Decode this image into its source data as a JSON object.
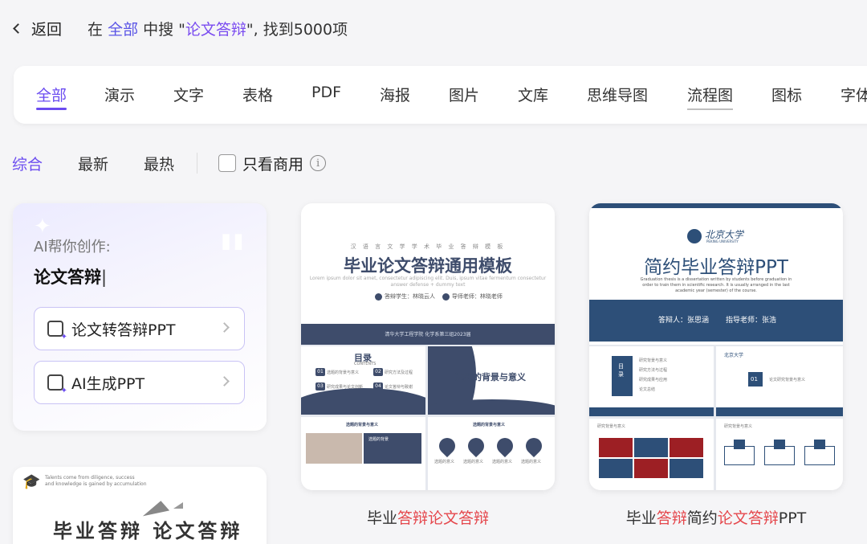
{
  "topbar": {
    "back_label": "返回",
    "summary_prefix": "在 ",
    "scope": "全部",
    "summary_mid": " 中搜 \"",
    "keyword": "论文答辩",
    "summary_suffix": "\", 找到5000项"
  },
  "tabs": [
    "全部",
    "演示",
    "文字",
    "表格",
    "PDF",
    "海报",
    "图片",
    "文库",
    "思维导图",
    "流程图",
    "图标",
    "字体"
  ],
  "active_tab": "全部",
  "sort": {
    "options": [
      "综合",
      "最新",
      "最热"
    ],
    "active": "综合",
    "commercial_only_label": "只看商用"
  },
  "ai_card": {
    "label": "AI帮你创作:",
    "topic": "论文答辩",
    "buttons": [
      "论文转答辩PPT",
      "AI生成PPT"
    ]
  },
  "bottom_left_preview": {
    "small_text_1": "Talents come from diligence, success",
    "small_text_2": "and knowledge is gained by accumulation",
    "big_text": "毕业答辩 论文答辩"
  },
  "card1": {
    "preview": {
      "small_caption": "汉 语 言 文 学 学 术 毕 业 答 辩 模 板",
      "title": "毕业论文答辩通用模板",
      "subtitle": "Lorem ipsum dolor sit amet, consectetur adipiscing elit. Duis, ipsum vitae fermentum consectetur",
      "subtitle_2": "answer defense + dummy text",
      "speaker": "答辩学生：林晓云人",
      "advisor": "导师老师：林晓老师",
      "school": "清华大学工程学院 化学系第三组2023届",
      "toc_title": "目录",
      "toc_sub": "CONTENTS",
      "toc_items": [
        "选题的背景与意义",
        "研究方法及过程",
        "研究成果与论文创新",
        "论文答辩与致谢"
      ],
      "slide2_title": "选题的背景与意义",
      "slide3_title": "选题的背景与意义",
      "slide3_box": "选题的背景",
      "slide4_title": "选题的背景与意义",
      "pin_labels": [
        "选题的意义",
        "选题的意义",
        "选题的意义",
        "选题的意义"
      ]
    },
    "title_parts": [
      {
        "text": "毕业",
        "highlight": false
      },
      {
        "text": "答辩论文答辩",
        "highlight": true
      }
    ]
  },
  "card2": {
    "preview": {
      "logo_text": "北京大学",
      "logo_sub": "PEKING UNIVERSITY",
      "title": "简约毕业答辩PPT",
      "subtitle": "Graduation thesis is a dissertation written by students before graduation in order to train them in scientific research. It is usually arranged in the last academic year (semester) of the course.",
      "speaker": "答辩人：张思涵",
      "advisor": "指导老师：张浩",
      "toc_side": "目录",
      "toc_items": [
        "研究背景与意义",
        "研究方法与过程",
        "研究成果与应用",
        "论文总结"
      ],
      "section_num": "01",
      "section_title": "论文研究背景与意义",
      "slide3_title": "研究背景与意义",
      "slide4_title": "研究背景与意义"
    },
    "title_parts": [
      {
        "text": "毕业",
        "highlight": false
      },
      {
        "text": "答辩",
        "highlight": true
      },
      {
        "text": "简约",
        "highlight": false
      },
      {
        "text": "论文答辩",
        "highlight": true
      },
      {
        "text": "PPT",
        "highlight": false
      }
    ]
  }
}
